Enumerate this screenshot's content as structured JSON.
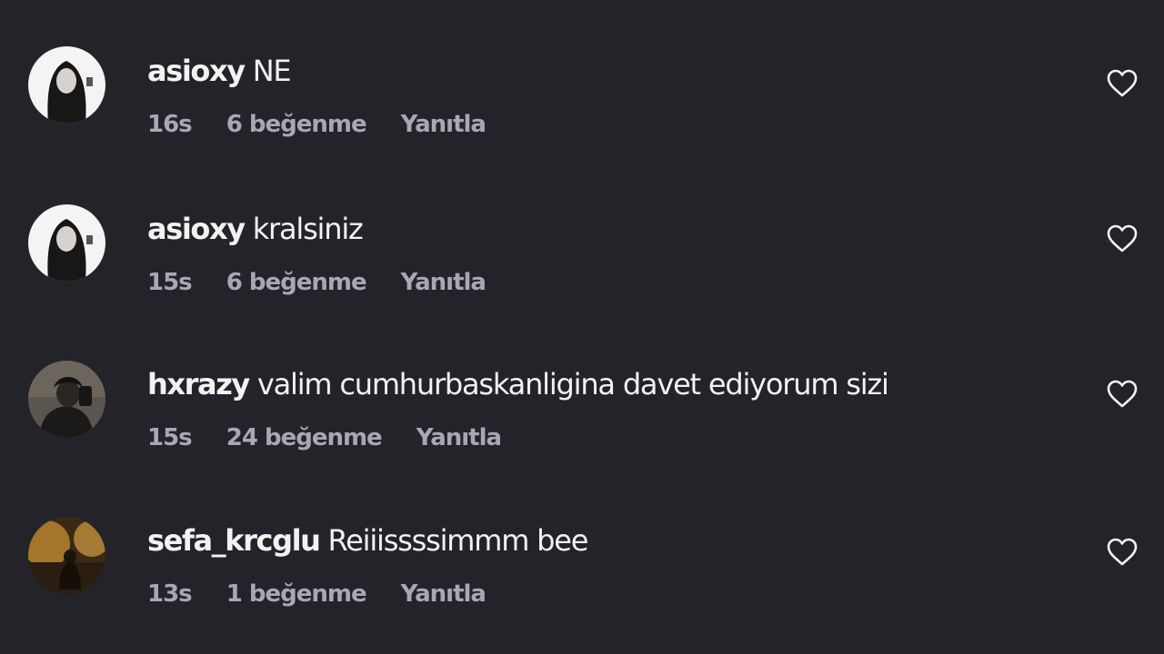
{
  "comments": [
    {
      "username": "asioxy",
      "text": "NE",
      "time": "16s",
      "likes": "6 beğenme",
      "reply": "Yanıtla"
    },
    {
      "username": "asioxy",
      "text": "kralsiniz",
      "time": "15s",
      "likes": "6 beğenme",
      "reply": "Yanıtla"
    },
    {
      "username": "hxrazy",
      "text": "valim cumhurbaskanligina davet ediyorum sizi",
      "time": "15s",
      "likes": "24 beğenme",
      "reply": "Yanıtla"
    },
    {
      "username": "sefa_krcglu",
      "text": "Reiiissssimmm bee",
      "time": "13s",
      "likes": "1 beğenme",
      "reply": "Yanıtla"
    }
  ],
  "icons": {
    "like": "heart-outline-icon"
  },
  "colors": {
    "background": "#232329",
    "text": "#f2f2f2",
    "meta": "#a8a8b0"
  }
}
